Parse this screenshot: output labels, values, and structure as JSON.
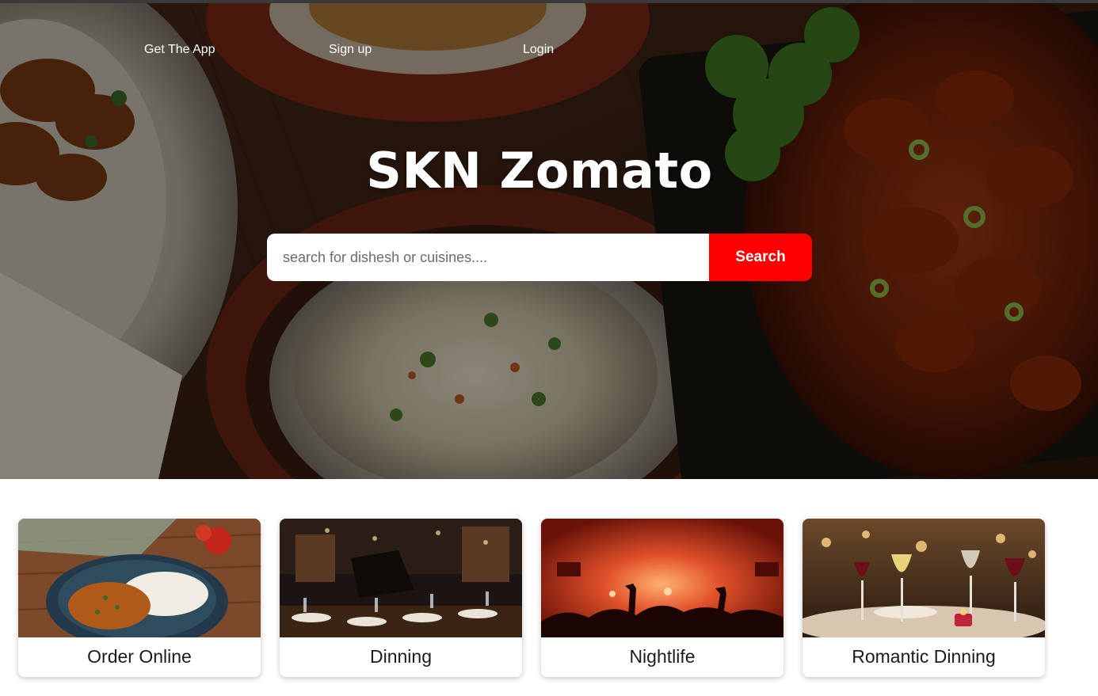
{
  "nav": {
    "get_app": "Get The App",
    "signup": "Sign up",
    "login": "Login"
  },
  "hero": {
    "title": "SKN Zomato"
  },
  "search": {
    "placeholder": "search for dishesh or cuisines....",
    "button_label": "Search"
  },
  "colors": {
    "accent": "#ff0000",
    "nav_text": "#ffffff"
  },
  "cards": [
    {
      "label": "Order Online",
      "image": "plated-curry-rice-photo"
    },
    {
      "label": "Dinning",
      "image": "restaurant-interior-photo"
    },
    {
      "label": "Nightlife",
      "image": "concert-crowd-photo"
    },
    {
      "label": "Romantic Dinning",
      "image": "wine-glasses-table-photo"
    }
  ]
}
